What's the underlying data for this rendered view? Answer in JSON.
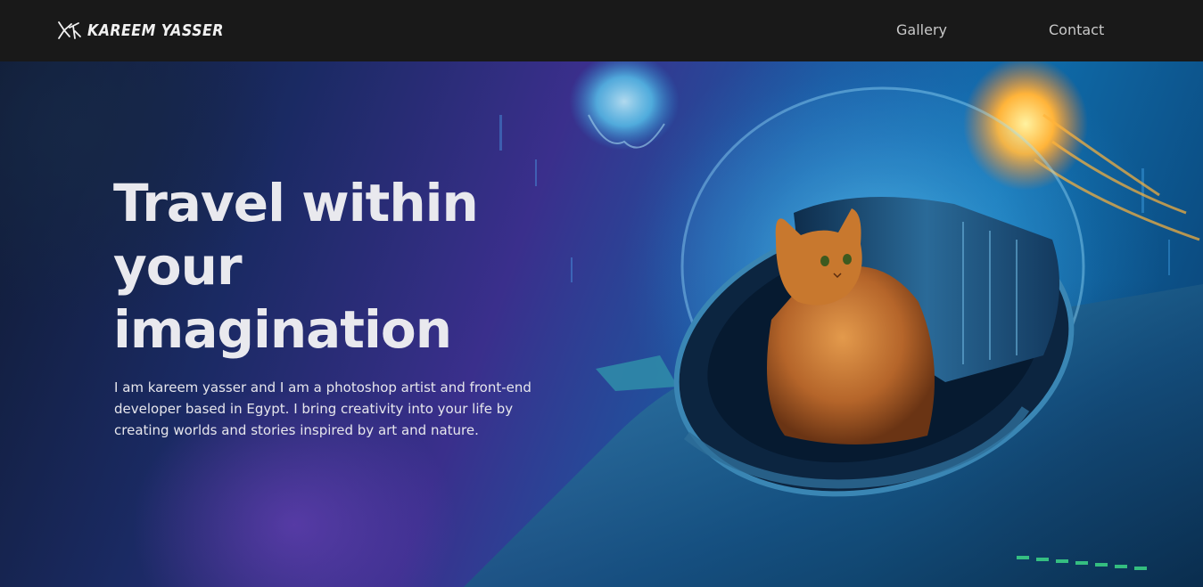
{
  "navbar": {
    "brand_name": "KAREEM YASSER",
    "links": [
      {
        "label": "Gallery"
      },
      {
        "label": "Contact"
      }
    ]
  },
  "hero": {
    "title": "Travel within your imagination",
    "description": "I am kareem yasser and I am a photoshop artist and front-end developer based in Egypt. I bring creativity into your life by creating worlds and stories inspired by art and nature."
  },
  "icons": {
    "brand_logo": "ky-monogram-icon"
  },
  "colors": {
    "navbar_bg": "#191919",
    "nav_text": "#c9c9c9",
    "hero_text": "#e9e9ee",
    "cat_orange": "#c8782e",
    "jellyfish_orange": "#ffb43a",
    "jellyfish_blue": "#5fe0ff"
  }
}
